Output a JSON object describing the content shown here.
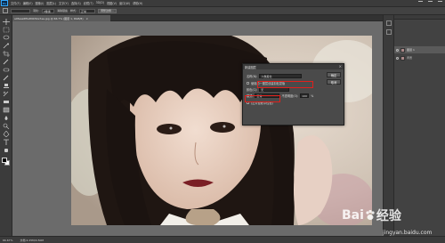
{
  "menubar": {
    "logo": "Ps",
    "items": [
      "文件(F)",
      "编辑(E)",
      "图像(I)",
      "图层(L)",
      "文字(Y)",
      "选择(S)",
      "滤镜(T)",
      "3D(D)",
      "视图(V)",
      "窗口(W)",
      "帮助(H)"
    ]
  },
  "optbar": {
    "feather_label": "羽化:",
    "feather_value": "0像素",
    "antialias_label": "消除锯齿",
    "style_label": "样式:",
    "style_value": "正常",
    "refine_btn": "调整边缘..."
  },
  "doctab": {
    "title": "a9feaa6f0e89b54e7ee.jpg @ 66.7% (图层 1, RGB/8)",
    "close": "×"
  },
  "status": {
    "zoom": "66.67%",
    "doc": "文档:2.25M/4.50M"
  },
  "dialog": {
    "title": "新建图层",
    "close": "×",
    "name_label": "名称(N):",
    "name_value": "人像美化",
    "mode_label": "模式:",
    "mode_value": "正常",
    "opacity_label": "不透明度(O):",
    "opacity_value": "100",
    "opacity_unit": "%",
    "clip_label": "使用前一图层创建剪贴蒙版",
    "color_label": "颜色(C):",
    "color_value": "无",
    "fill_label": "(正片叠底中性色)",
    "ok": "确定",
    "cancel": "取消",
    "preview_label": "预览(P)"
  },
  "layers": {
    "rows": [
      {
        "name": "图层 1"
      },
      {
        "name": "背景"
      }
    ]
  },
  "watermark": {
    "brand_a": "Bai",
    "brand_b": "经验",
    "url": "jingyan.baidu.com"
  },
  "colors": {
    "highlight": "#e0201c",
    "accent": "#31a8ff"
  }
}
